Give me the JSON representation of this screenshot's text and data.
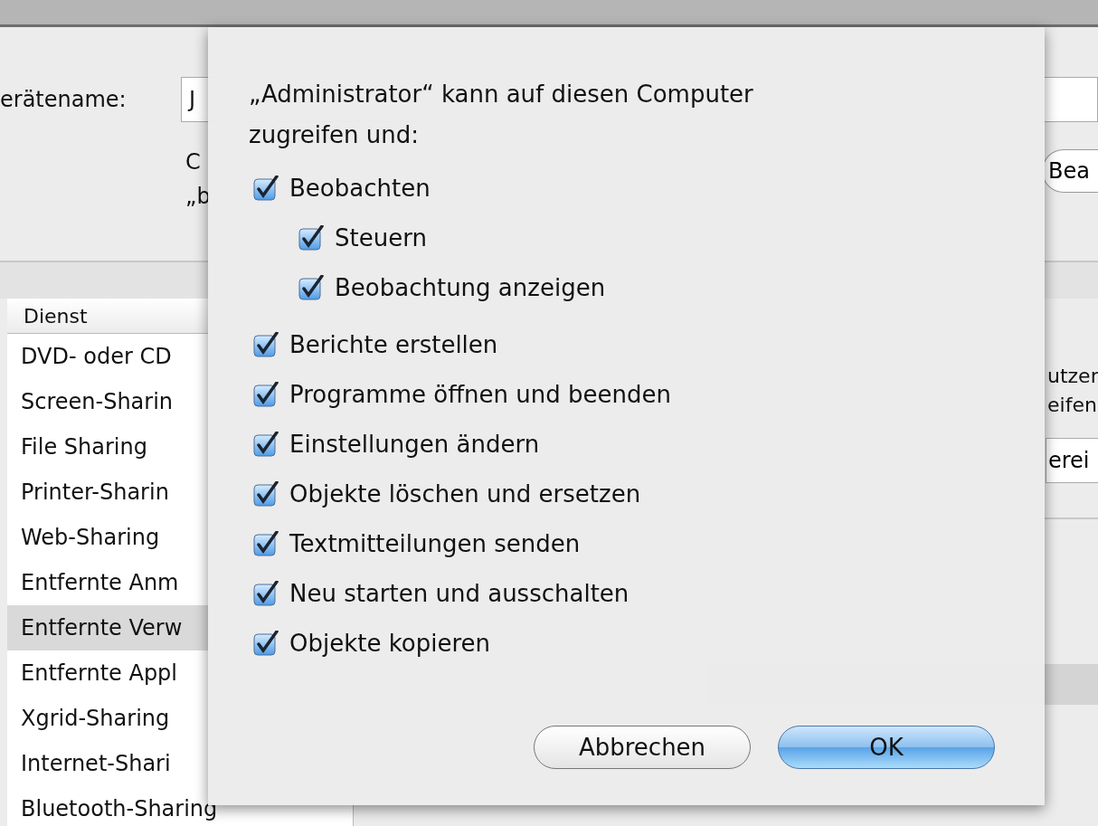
{
  "window": {
    "device_name_label": "erätename:",
    "device_name_value": "J",
    "description_fragments": [
      "C",
      "„b"
    ],
    "edit_button": "Bea"
  },
  "services": {
    "column": "Dienst",
    "items": [
      {
        "label": "DVD- oder CD",
        "selected": false
      },
      {
        "label": "Screen-Sharin",
        "selected": false
      },
      {
        "label": "File Sharing",
        "selected": false
      },
      {
        "label": "Printer-Sharin",
        "selected": false
      },
      {
        "label": "Web-Sharing",
        "selected": false
      },
      {
        "label": "Entfernte Anm",
        "selected": false
      },
      {
        "label": "Entfernte Verw",
        "selected": true
      },
      {
        "label": "Entfernte Appl",
        "selected": false
      },
      {
        "label": "Xgrid-Sharing",
        "selected": false
      },
      {
        "label": "Internet-Shari",
        "selected": false
      },
      {
        "label": "Bluetooth-Sharing",
        "selected": false
      }
    ]
  },
  "right_pane": {
    "text_fragments": [
      "utzer",
      "eifen"
    ],
    "button": "erei"
  },
  "sheet": {
    "prompt": "„Administrator“ kann auf diesen Computer zugreifen und:",
    "permissions": [
      {
        "label": "Beobachten",
        "checked": true,
        "children": [
          {
            "label": "Steuern",
            "checked": true
          },
          {
            "label": "Beobachtung anzeigen",
            "checked": true
          }
        ]
      },
      {
        "label": "Berichte erstellen",
        "checked": true
      },
      {
        "label": "Programme öffnen und beenden",
        "checked": true
      },
      {
        "label": "Einstellungen ändern",
        "checked": true
      },
      {
        "label": "Objekte löschen und ersetzen",
        "checked": true
      },
      {
        "label": "Textmitteilungen senden",
        "checked": true
      },
      {
        "label": "Neu starten und ausschalten",
        "checked": true
      },
      {
        "label": "Objekte kopieren",
        "checked": true
      }
    ],
    "buttons": [
      {
        "label": "Abbrechen",
        "kind": "cancel"
      },
      {
        "label": "OK",
        "kind": "default"
      }
    ]
  }
}
